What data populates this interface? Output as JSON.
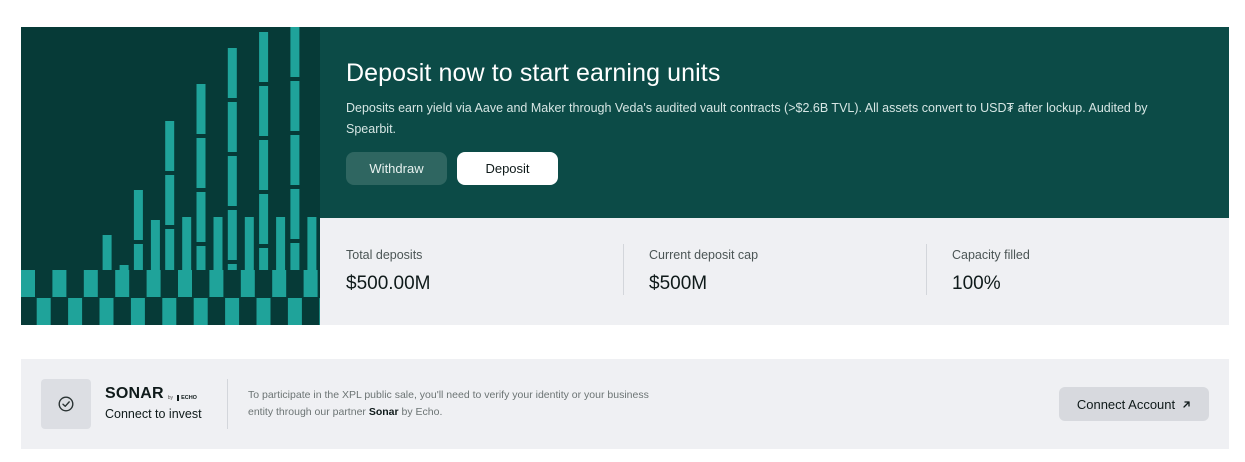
{
  "hero": {
    "title": "Deposit now to start earning units",
    "description": "Deposits earn yield via Aave and Maker through Veda's audited vault contracts (>$2.6B TVL). All assets convert to USD₮ after lockup. Audited by Spearbit.",
    "withdraw_label": "Withdraw",
    "deposit_label": "Deposit",
    "colors": {
      "background": "#0c4b47",
      "art_bg": "#063a37",
      "art_bar": "#1fa39a"
    }
  },
  "stats": [
    {
      "label": "Total deposits",
      "value": "$500.00M"
    },
    {
      "label": "Current deposit cap",
      "value": "$500M"
    },
    {
      "label": "Capacity filled",
      "value": "100%"
    }
  ],
  "sonar": {
    "logo": "SONAR",
    "by": "by",
    "echo": "ECHO",
    "tagline": "Connect to invest",
    "text_before": "To participate in the XPL public sale, you'll need to verify your identity or your business entity through our partner ",
    "partner": "Sonar",
    "text_after": " by Echo.",
    "connect_label": "Connect Account",
    "icons": {
      "badge": "check-circle-icon",
      "connect": "arrow-up-right-icon"
    }
  }
}
